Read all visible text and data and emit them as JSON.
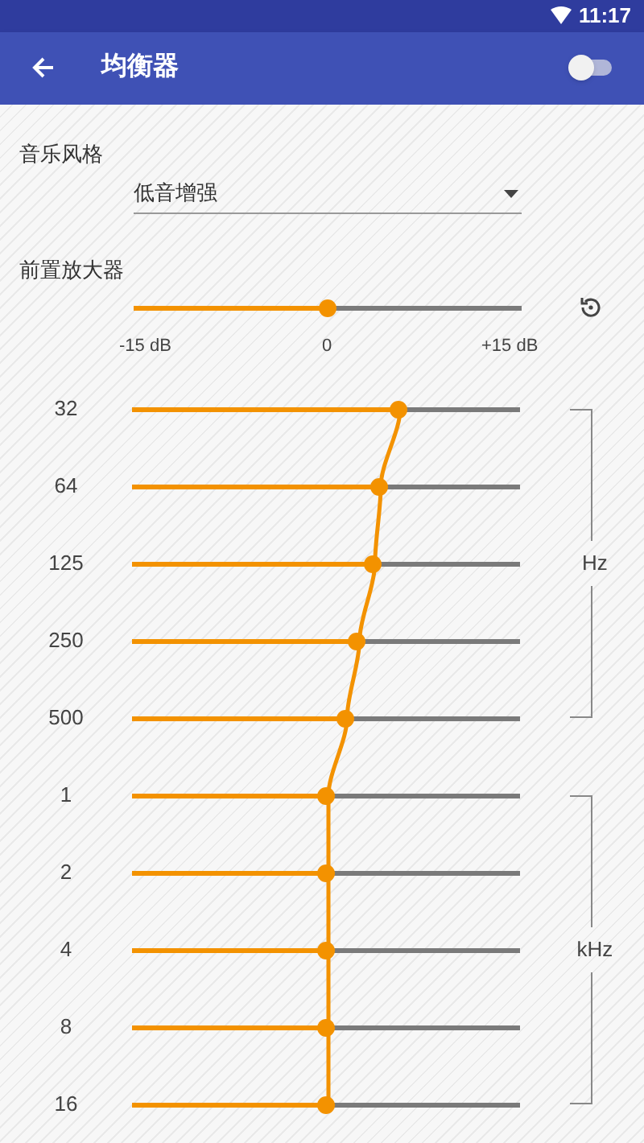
{
  "status_bar": {
    "time": "11:17"
  },
  "app_bar": {
    "title": "均衡器",
    "on": false
  },
  "style": {
    "label": "音乐风格",
    "value": "低音增强"
  },
  "preamp": {
    "label": "前置放大器",
    "level": 0.5,
    "scale": [
      "-15 dB",
      "0",
      "+15 dB"
    ]
  },
  "band_groups": [
    {
      "unit": "Hz",
      "bands": [
        {
          "label": "32",
          "level": 0.685
        },
        {
          "label": "64",
          "level": 0.635
        },
        {
          "label": "125",
          "level": 0.62
        },
        {
          "label": "250",
          "level": 0.58
        },
        {
          "label": "500",
          "level": 0.548
        }
      ]
    },
    {
      "unit": "kHz",
      "bands": [
        {
          "label": "1",
          "level": 0.5
        },
        {
          "label": "2",
          "level": 0.5
        },
        {
          "label": "4",
          "level": 0.5
        },
        {
          "label": "8",
          "level": 0.5
        },
        {
          "label": "16",
          "level": 0.5
        }
      ]
    }
  ]
}
